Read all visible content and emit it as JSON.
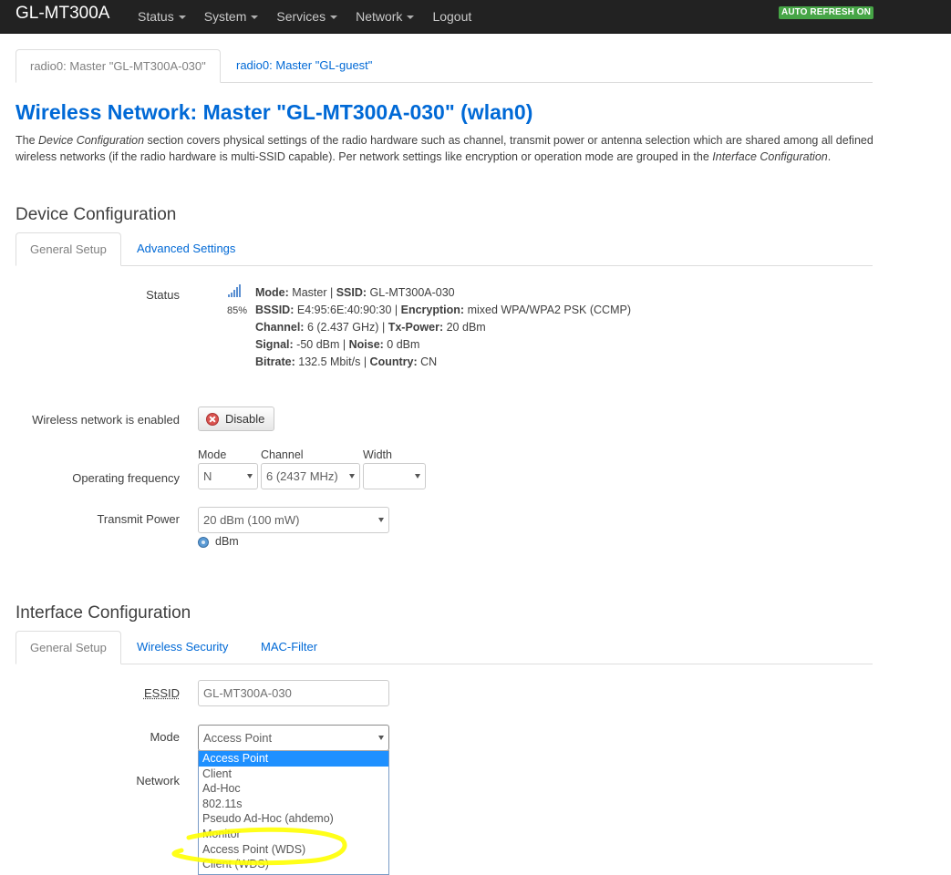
{
  "topbar": {
    "brand": "GL-MT300A",
    "nav": [
      "Status",
      "System",
      "Services",
      "Network",
      "Logout"
    ],
    "refresh_badge": "AUTO REFRESH ON"
  },
  "top_tabs": [
    "radio0: Master \"GL-MT300A-030\"",
    "radio0: Master \"GL-guest\""
  ],
  "page": {
    "title": "Wireless Network: Master \"GL-MT300A-030\" (wlan0)",
    "intro_1": "The ",
    "intro_em1": "Device Configuration",
    "intro_2": " section covers physical settings of the radio hardware such as channel, transmit power or antenna selection which are shared among all defined wireless networks (if the radio hardware is multi-SSID capable). Per network settings like encryption or operation mode are grouped in the ",
    "intro_em2": "Interface Configuration",
    "intro_3": "."
  },
  "device": {
    "title": "Device Configuration",
    "tabs": [
      "General Setup",
      "Advanced Settings"
    ],
    "status_label": "Status",
    "signal_percent": "85%",
    "status": {
      "mode_label": "Mode:",
      "mode": "Master",
      "ssid_label": "SSID:",
      "ssid": "GL-MT300A-030",
      "bssid_label": "BSSID:",
      "bssid": "E4:95:6E:40:90:30",
      "enc_label": "Encryption:",
      "enc": "mixed WPA/WPA2 PSK (CCMP)",
      "channel_label": "Channel:",
      "channel": "6 (2.437 GHz)",
      "txpower_label": "Tx-Power:",
      "txpower": "20 dBm",
      "signal_label": "Signal:",
      "signal": "-50 dBm",
      "noise_label": "Noise:",
      "noise": "0 dBm",
      "bitrate_label": "Bitrate:",
      "bitrate": "132.5 Mbit/s",
      "country_label": "Country:",
      "country": "CN"
    },
    "enabled_label": "Wireless network is enabled",
    "disable_button": "Disable",
    "freq_label": "Operating frequency",
    "mode_col": "Mode",
    "channel_col": "Channel",
    "width_col": "Width",
    "mode_value": "N",
    "channel_value": "6 (2437 MHz)",
    "width_value": "",
    "txpower_label": "Transmit Power",
    "txpower_value": "20 dBm (100 mW)",
    "txpower_unit": "dBm"
  },
  "iface": {
    "title": "Interface Configuration",
    "tabs": [
      "General Setup",
      "Wireless Security",
      "MAC-Filter"
    ],
    "essid_label": "ESSID",
    "essid_value": "GL-MT300A-030",
    "mode_label": "Mode",
    "mode_value": "Access Point",
    "network_label": "Network",
    "mode_options": [
      "Access Point",
      "Client",
      "Ad-Hoc",
      "802.11s",
      "Pseudo Ad-Hoc (ahdemo)",
      "Monitor",
      "Access Point (WDS)",
      "Client (WDS)"
    ]
  },
  "colors": {
    "link": "#0069d6",
    "topbar": "#222222",
    "badge": "#46a546",
    "highlight": "#ffff00"
  }
}
